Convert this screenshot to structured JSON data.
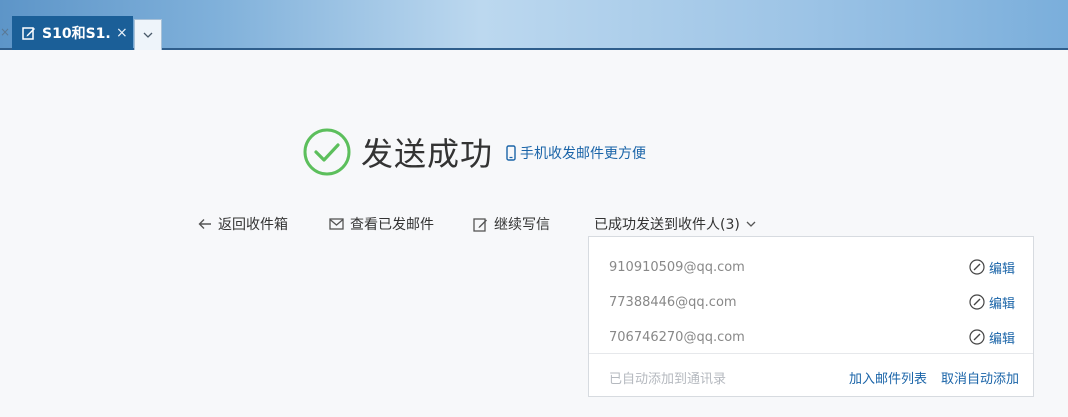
{
  "tabs": {
    "prev_close": "×",
    "active_label": "S10和S1...",
    "active_close": "×",
    "dropdown": "⌄"
  },
  "success": {
    "title": "发送成功",
    "mobile_link": "手机收发邮件更方便"
  },
  "actions": {
    "back_to_inbox": "返回收件箱",
    "view_sent": "查看已发邮件",
    "continue_writing": "继续写信",
    "recipients_label": "已成功发送到收件人(3)"
  },
  "recipients": {
    "items": [
      {
        "email": "910910509@qq.com",
        "edit_label": "编辑"
      },
      {
        "email": "77388446@qq.com",
        "edit_label": "编辑"
      },
      {
        "email": "706746270@qq.com",
        "edit_label": "编辑"
      }
    ],
    "auto_added_text": "已自动添加到通讯录",
    "add_to_list": "加入邮件列表",
    "cancel_auto_add": "取消自动添加"
  },
  "colors": {
    "accent": "#1a64a8",
    "success_green": "#5cbf5c",
    "tab_active": "#1b5f98"
  }
}
